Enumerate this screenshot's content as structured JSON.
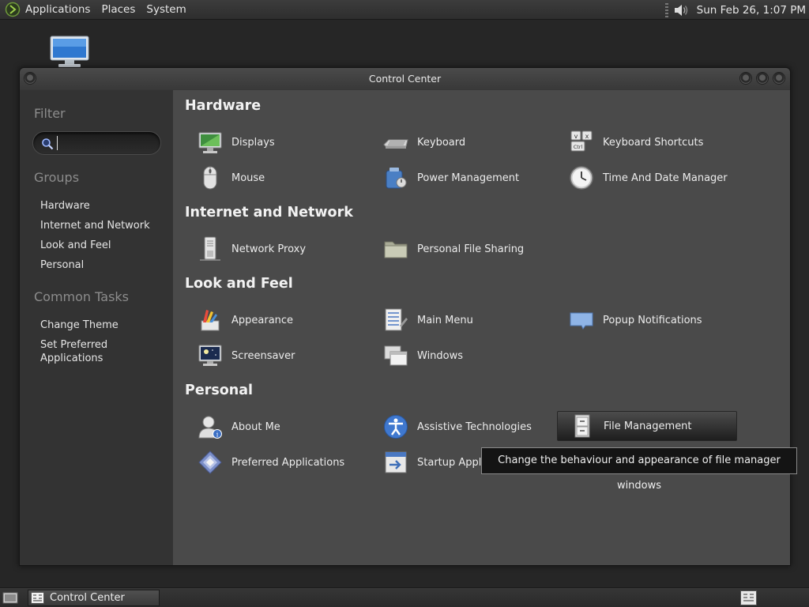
{
  "top_panel": {
    "menus": [
      "Applications",
      "Places",
      "System"
    ],
    "clock": "Sun Feb 26,  1:07 PM"
  },
  "window": {
    "title": "Control Center"
  },
  "sidebar": {
    "filter_heading": "Filter",
    "search_value": "",
    "groups_heading": "Groups",
    "groups": [
      "Hardware",
      "Internet and Network",
      "Look and Feel",
      "Personal"
    ],
    "tasks_heading": "Common Tasks",
    "tasks": [
      "Change Theme",
      "Set Preferred\nApplications"
    ]
  },
  "sections": [
    {
      "title": "Hardware",
      "items": [
        {
          "label": "Displays",
          "icon": "display-icon"
        },
        {
          "label": "Keyboard",
          "icon": "keyboard-icon"
        },
        {
          "label": "Keyboard Shortcuts",
          "icon": "keyboard-shortcuts-icon"
        },
        {
          "label": "Mouse",
          "icon": "mouse-icon"
        },
        {
          "label": "Power Management",
          "icon": "power-management-icon"
        },
        {
          "label": "Time And Date Manager",
          "icon": "clock-icon"
        }
      ]
    },
    {
      "title": "Internet and Network",
      "items": [
        {
          "label": "Network Proxy",
          "icon": "network-proxy-icon"
        },
        {
          "label": "Personal File Sharing",
          "icon": "folder-share-icon"
        }
      ]
    },
    {
      "title": "Look and Feel",
      "items": [
        {
          "label": "Appearance",
          "icon": "appearance-icon"
        },
        {
          "label": "Main Menu",
          "icon": "main-menu-icon"
        },
        {
          "label": "Popup Notifications",
          "icon": "notification-icon"
        },
        {
          "label": "Screensaver",
          "icon": "screensaver-icon"
        },
        {
          "label": "Windows",
          "icon": "windows-icon"
        }
      ]
    },
    {
      "title": "Personal",
      "items": [
        {
          "label": "About Me",
          "icon": "about-me-icon"
        },
        {
          "label": "Assistive Technologies",
          "icon": "accessibility-icon"
        },
        {
          "label": "File Management",
          "icon": "file-cabinet-icon"
        },
        {
          "label": "Preferred Applications",
          "icon": "preferred-apps-icon"
        },
        {
          "label": "Startup Applications",
          "icon": "startup-apps-icon"
        }
      ]
    }
  ],
  "tooltip": "Change the behaviour and appearance of file manager windows",
  "taskbar": {
    "task_label": "Control Center"
  },
  "colors": {
    "panel": "#2e2e2e",
    "sidebar": "#333333",
    "content": "#4a4a4a",
    "text": "#ececec",
    "muted_heading": "#8c8c8c"
  }
}
